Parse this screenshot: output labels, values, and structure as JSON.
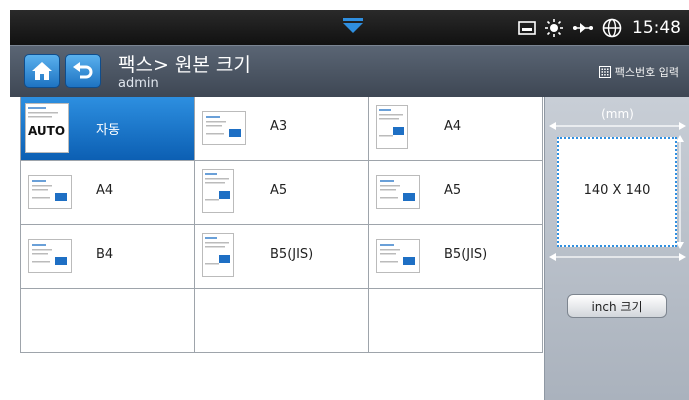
{
  "status_bar": {
    "time": "15:48",
    "icons": [
      "pull-down-tab-icon",
      "toner-icon",
      "sun-icon",
      "network-icon",
      "globe-icon"
    ]
  },
  "header": {
    "title": "팩스> 원본 크기",
    "user": "admin",
    "fax_number_button": "팩스번호 입력",
    "buttons": [
      "home-icon",
      "back-icon"
    ]
  },
  "sizes": {
    "items": [
      {
        "label": "자동",
        "thumb": "AUTO",
        "orientation": "auto",
        "selected": true
      },
      {
        "label": "A3",
        "orientation": "landscape",
        "selected": false
      },
      {
        "label": "A4",
        "orientation": "portrait",
        "selected": false
      },
      {
        "label": "A4",
        "orientation": "landscape",
        "selected": false
      },
      {
        "label": "A5",
        "orientation": "portrait",
        "selected": false
      },
      {
        "label": "A5",
        "orientation": "landscape",
        "selected": false
      },
      {
        "label": "B4",
        "orientation": "landscape",
        "selected": false
      },
      {
        "label": "B5(JIS)",
        "orientation": "portrait",
        "selected": false
      },
      {
        "label": "B5(JIS)",
        "orientation": "landscape",
        "selected": false
      }
    ]
  },
  "preview": {
    "unit": "(mm)",
    "dimension": "140 X 140",
    "inch_button": "inch 크기"
  },
  "colors": {
    "selected": "#1a7ad0",
    "title_bar": "#4b5562",
    "panel": "#b8bfc8"
  }
}
